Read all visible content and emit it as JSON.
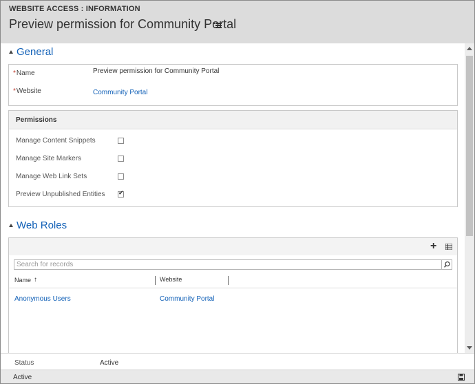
{
  "header": {
    "entity_label": "WEBSITE ACCESS : INFORMATION",
    "record_title": "Preview permission for Community Portal",
    "menu_icon": "list-menu-icon"
  },
  "general": {
    "section_title": "General",
    "fields": [
      {
        "label": "Name",
        "value": "Preview permission for Community Portal",
        "required": true
      },
      {
        "label": "Website",
        "value": "Community Portal",
        "required": true,
        "link": true
      }
    ]
  },
  "permissions": {
    "title": "Permissions",
    "items": [
      {
        "label": "Manage Content Snippets",
        "checked": false
      },
      {
        "label": "Manage Site Markers",
        "checked": false
      },
      {
        "label": "Manage Web Link Sets",
        "checked": false
      },
      {
        "label": "Preview Unpublished Entities",
        "checked": true
      }
    ]
  },
  "web_roles": {
    "section_title": "Web Roles",
    "search_placeholder": "Search for records",
    "columns": [
      {
        "label": "Name",
        "sort": "ascending"
      },
      {
        "label": "Website"
      }
    ],
    "rows": [
      {
        "name": "Anonymous Users",
        "website": "Community Portal"
      }
    ]
  },
  "footer": {
    "status_label": "Status",
    "status_value": "Active",
    "statusbar_text": "Active"
  },
  "colors": {
    "accent": "#1160b7",
    "required": "#c0392b",
    "header_bg": "#dcdcdc"
  }
}
